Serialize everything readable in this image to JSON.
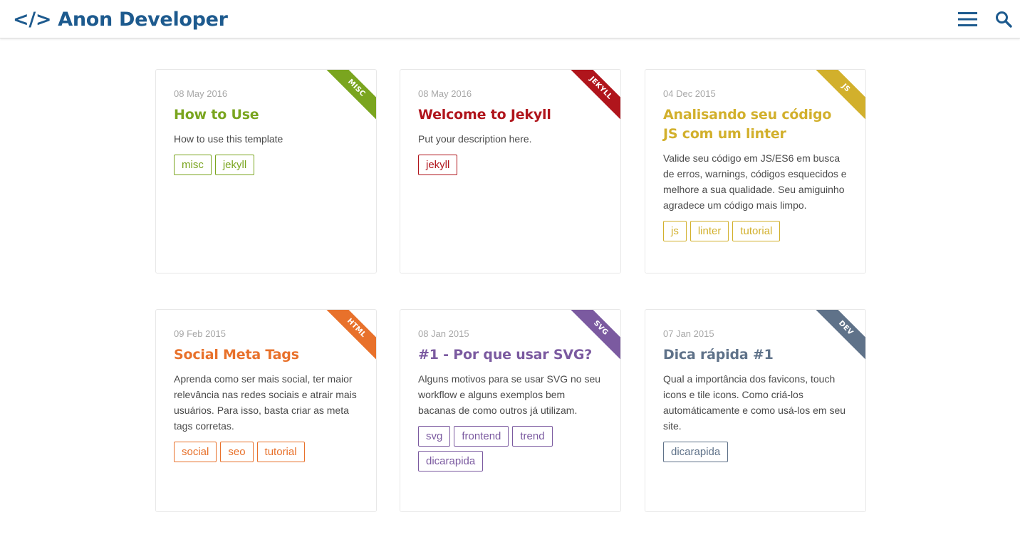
{
  "header": {
    "brand_symbol": "</>",
    "brand_name": "Anon Developer",
    "brand_color": "#1d5a8e",
    "menu_icon": "hamburger-icon",
    "search_icon": "search-icon"
  },
  "posts": [
    {
      "category": "MISC",
      "color": "#7aa51f",
      "date": "08 May 2016",
      "title": "How to Use",
      "description": "How to use this template",
      "tags": [
        "misc",
        "jekyll"
      ]
    },
    {
      "category": "JEKYLL",
      "color": "#b0151c",
      "date": "08 May 2016",
      "title": "Welcome to Jekyll",
      "description": "Put your description here.",
      "tags": [
        "jekyll"
      ]
    },
    {
      "category": "JS",
      "color": "#d2b02c",
      "date": "04 Dec 2015",
      "title": "Analisando seu código JS com um linter",
      "description": "Valide seu código em JS/ES6 em busca de erros, warnings, códigos esquecidos e melhore a sua qualidade. Seu amiguinho agradece um código mais limpo.",
      "tags": [
        "js",
        "linter",
        "tutorial"
      ]
    },
    {
      "category": "HTML",
      "color": "#e8712b",
      "date": "09 Feb 2015",
      "title": "Social Meta Tags",
      "description": "Aprenda como ser mais social, ter maior relevância nas redes sociais e atrair mais usuários. Para isso, basta criar as meta tags corretas.",
      "tags": [
        "social",
        "seo",
        "tutorial"
      ]
    },
    {
      "category": "SVG",
      "color": "#7b5aa0",
      "date": "08 Jan 2015",
      "title": "#1 - Por que usar SVG?",
      "description": "Alguns motivos para se usar SVG no seu workflow e alguns exemplos bem bacanas de como outros já utilizam.",
      "tags": [
        "svg",
        "frontend",
        "trend",
        "dicarapida"
      ]
    },
    {
      "category": "DEV",
      "color": "#5f7289",
      "date": "07 Jan 2015",
      "title": "Dica rápida #1",
      "description": "Qual a importância dos favicons, touch icons e tile icons. Como criá-los automáticamente e como usá-los em seu site.",
      "tags": [
        "dicarapida"
      ]
    }
  ]
}
